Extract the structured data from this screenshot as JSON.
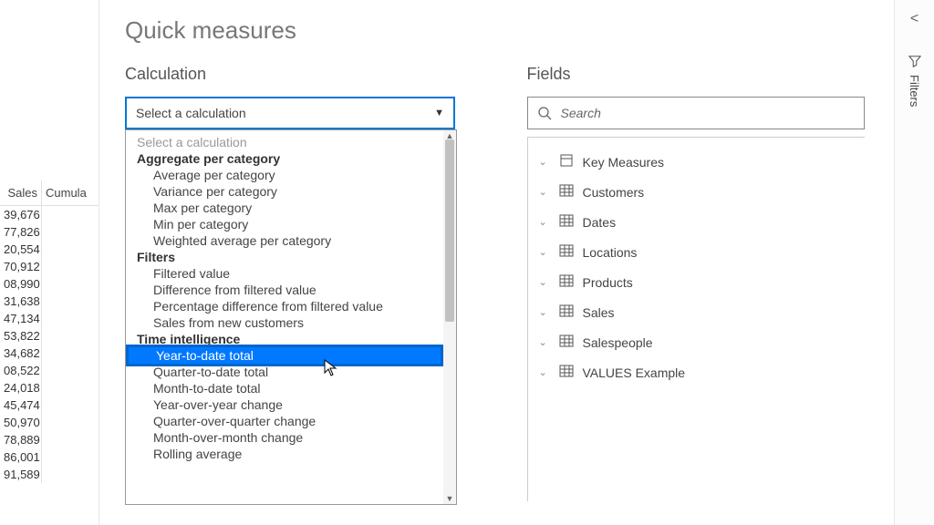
{
  "modal": {
    "title": "Quick measures",
    "calculation_label": "Calculation",
    "fields_label": "Fields",
    "select_placeholder": "Select a calculation",
    "search_placeholder": "Search"
  },
  "dropdown": {
    "placeholder": "Select a calculation",
    "groups": [
      {
        "label": "Aggregate per category",
        "items": [
          "Average per category",
          "Variance per category",
          "Max per category",
          "Min per category",
          "Weighted average per category"
        ]
      },
      {
        "label": "Filters",
        "items": [
          "Filtered value",
          "Difference from filtered value",
          "Percentage difference from filtered value",
          "Sales from new customers"
        ]
      },
      {
        "label": "Time intelligence",
        "items": [
          "Year-to-date total",
          "Quarter-to-date total",
          "Month-to-date total",
          "Year-over-year change",
          "Quarter-over-quarter change",
          "Month-over-month change",
          "Rolling average"
        ]
      }
    ],
    "selected": "Year-to-date total"
  },
  "fields": [
    {
      "name": "Key Measures",
      "icon": "measures"
    },
    {
      "name": "Customers",
      "icon": "table"
    },
    {
      "name": "Dates",
      "icon": "table"
    },
    {
      "name": "Locations",
      "icon": "table"
    },
    {
      "name": "Products",
      "icon": "table"
    },
    {
      "name": "Sales",
      "icon": "table"
    },
    {
      "name": "Salespeople",
      "icon": "table"
    },
    {
      "name": "VALUES Example",
      "icon": "table"
    }
  ],
  "rail": {
    "filters": "Filters"
  },
  "bg_table": {
    "col1": " Sales",
    "col2": "Cumula",
    "rows": [
      "39,676",
      "77,826",
      "20,554",
      "70,912",
      "08,990",
      "31,638",
      "47,134",
      "53,822",
      "34,682",
      "08,522",
      "24,018",
      "45,474",
      "50,970",
      "78,889",
      "86,001",
      "91,589"
    ]
  }
}
